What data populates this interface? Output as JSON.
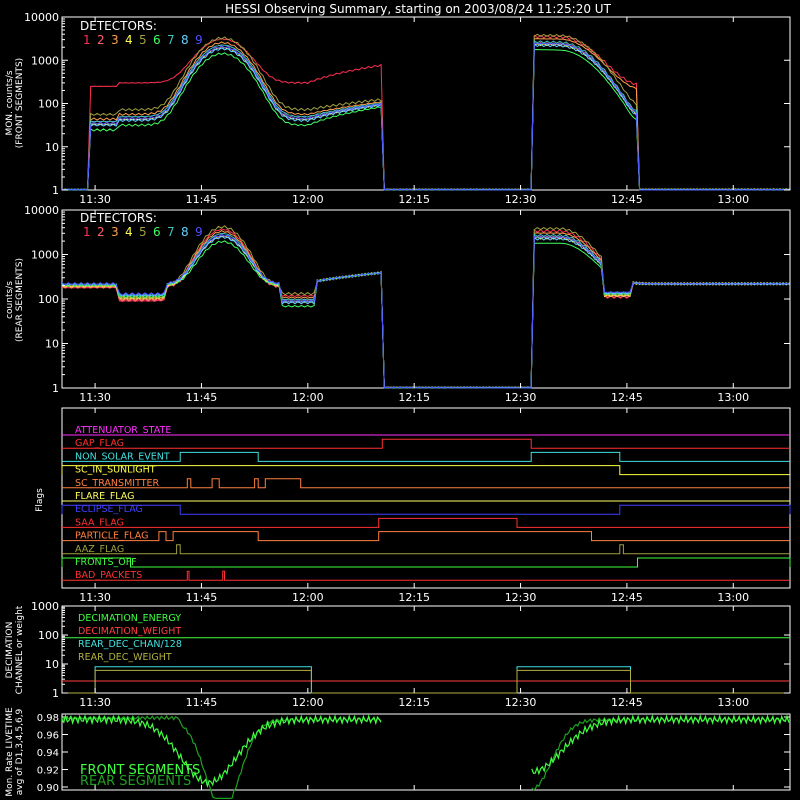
{
  "colors": {
    "background": "#000000",
    "axis": "#ffffff",
    "det": [
      "#ff3050",
      "#ff6070",
      "#ffa050",
      "#ffff50",
      "#a0a040",
      "#40ff60",
      "#40c0c0",
      "#60d0ff",
      "#5050ff"
    ]
  },
  "chart_data": [
    {
      "type": "line",
      "title": "HESSI Observing Summary, starting on 2003/08/24 11:25:20 UT",
      "ylabel": [
        "MON. counts/s",
        "(FRONT SEGMENTS)"
      ],
      "yscale": "log",
      "ylim": [
        1,
        10000
      ],
      "xlim": [
        "11:25:20",
        "13:08:00"
      ],
      "x_ticks": [
        "11:30",
        "11:45",
        "12:00",
        "12:15",
        "12:30",
        "12:45",
        "13:00"
      ],
      "y_ticks": [
        "1",
        "10",
        "100",
        "1000",
        "10000"
      ],
      "legend_title": "DETECTORS:",
      "legend_entries": [
        "1",
        "2",
        "3",
        "4",
        "5",
        "6",
        "7",
        "8",
        "9"
      ],
      "series_profile": {
        "data_gaps": [
          [
            "11:25:20",
            "11:29:00"
          ],
          [
            "12:10:30",
            "12:31:30"
          ],
          [
            "12:46:30",
            "13:08:00"
          ]
        ],
        "peak": {
          "time": "11:48",
          "value": 2000
        },
        "det1_plateau": 300
      }
    },
    {
      "type": "line",
      "ylabel": [
        "counts/s",
        "(REAR SEGMENTS)"
      ],
      "yscale": "log",
      "ylim": [
        1,
        10000
      ],
      "x_ticks": [
        "11:30",
        "11:45",
        "12:00",
        "12:15",
        "12:30",
        "12:45",
        "13:00"
      ],
      "y_ticks": [
        "1",
        "10",
        "100",
        "1000",
        "10000"
      ],
      "legend_title": "DETECTORS:",
      "legend_entries": [
        "1",
        "2",
        "3",
        "4",
        "5",
        "6",
        "7",
        "8",
        "9"
      ],
      "series_profile": {
        "data_gaps": [
          [
            "12:10:30",
            "12:31:30"
          ]
        ],
        "peak": {
          "time": "11:48",
          "value": 2500
        },
        "baseline": 200
      }
    },
    {
      "type": "line",
      "ylabel": "Flags",
      "x_ticks": [
        "11:30",
        "11:45",
        "12:00",
        "12:15",
        "12:30",
        "12:45",
        "13:00"
      ],
      "flags": [
        {
          "name": "ATTENUATOR_STATE",
          "color": "#ff30ff",
          "on": []
        },
        {
          "name": "GAP_FLAG",
          "color": "#ff3030",
          "on": [
            [
              "12:10:30",
              "12:31:30"
            ]
          ]
        },
        {
          "name": "NON_SOLAR_EVENT",
          "color": "#40e0e0",
          "on": [
            [
              "11:42:00",
              "11:53:00"
            ],
            [
              "12:31:30",
              "12:44:00"
            ]
          ]
        },
        {
          "name": "SC_IN_SUNLIGHT",
          "color": "#ffff40",
          "on": [
            [
              "11:25:20",
              "12:44:00"
            ]
          ]
        },
        {
          "name": "SC_TRANSMITTER",
          "color": "#ff8040",
          "on": [
            [
              "11:43:00",
              "11:43:30"
            ],
            [
              "11:46:30",
              "11:47:30"
            ],
            [
              "11:52:30",
              "11:53:00"
            ],
            [
              "11:54:00",
              "11:59:00"
            ]
          ]
        },
        {
          "name": "FLARE_FLAG",
          "color": "#ffff60",
          "on": []
        },
        {
          "name": "ECLIPSE_FLAG",
          "color": "#4040ff",
          "on": [
            [
              "11:25:20",
              "11:42:00"
            ],
            [
              "12:44:00",
              "13:08:00"
            ]
          ]
        },
        {
          "name": "SAA_FLAG",
          "color": "#ff3030",
          "on": [
            [
              "12:10:00",
              "12:29:30"
            ]
          ]
        },
        {
          "name": "PARTICLE_FLAG",
          "color": "#ff8040",
          "on": [
            [
              "11:39:00",
              "11:40:00"
            ],
            [
              "11:41:00",
              "11:53:00"
            ],
            [
              "12:10:00",
              "12:40:00"
            ]
          ]
        },
        {
          "name": "AAZ_FLAG",
          "color": "#a0a040",
          "on": [
            [
              "11:41:30",
              "11:42:00"
            ],
            [
              "12:44:00",
              "12:44:30"
            ]
          ]
        },
        {
          "name": "FRONTS_OFF",
          "color": "#40ff40",
          "on": [
            [
              "11:25:20",
              "11:35:00"
            ],
            [
              "12:46:30",
              "13:08:00"
            ]
          ]
        },
        {
          "name": "BAD_PACKETS",
          "color": "#ff3030",
          "on": [
            [
              "11:43:00",
              "11:43:15"
            ],
            [
              "11:48:00",
              "11:48:15"
            ]
          ]
        }
      ]
    },
    {
      "type": "line",
      "ylabel": [
        "DECIMATION",
        "CHANNEL or weight"
      ],
      "yscale": "log",
      "ylim": [
        1,
        1000
      ],
      "x_ticks": [
        "11:30",
        "11:45",
        "12:00",
        "12:15",
        "12:30",
        "12:45",
        "13:00"
      ],
      "y_ticks": [
        "1",
        "10",
        "100",
        "1000"
      ],
      "legend_entries": [
        {
          "name": "DECIMATION_ENERGY",
          "color": "#40ff40"
        },
        {
          "name": "DECIMATION_WEIGHT",
          "color": "#ff4040"
        },
        {
          "name": "REAR_DEC_CHAN/128",
          "color": "#40e0e0"
        },
        {
          "name": "REAR_DEC_WEIGHT",
          "color": "#b0b040"
        }
      ],
      "series": [
        {
          "name": "DECIMATION_ENERGY",
          "value": 80
        },
        {
          "name": "DECIMATION_WEIGHT",
          "value": 2.6
        },
        {
          "name": "REAR_DEC_CHAN/128",
          "segments": [
            [
              "11:30:00",
              "12:00:30",
              8
            ],
            [
              "12:29:30",
              "12:45:30",
              8
            ]
          ],
          "base": 1
        },
        {
          "name": "REAR_DEC_WEIGHT",
          "segments": [
            [
              "11:30:00",
              "12:00:30",
              6
            ],
            [
              "12:29:30",
              "12:45:30",
              6
            ]
          ],
          "base": 1
        }
      ]
    },
    {
      "type": "line",
      "ylabel": [
        "Mon. Rate LIVETIME",
        "avg of D1,3,4,5,6,9"
      ],
      "ylim": [
        0.9,
        0.98
      ],
      "x_ticks": [
        "11:30",
        "11:45",
        "12:00",
        "12:15",
        "12:30",
        "12:45",
        "13:00"
      ],
      "y_ticks": [
        "0.90",
        "0.92",
        "0.94",
        "0.96",
        "0.98"
      ],
      "legend_entries": [
        {
          "name": "FRONT SEGMENTS",
          "color": "#40ff40"
        },
        {
          "name": "REAR SEGMENTS",
          "color": "#20a020"
        }
      ],
      "series_profile": {
        "baseline": 0.977,
        "dip_front": {
          "time": "11:46",
          "value": 0.905
        },
        "dip_rear": {
          "time": "11:48",
          "value": 0.88
        }
      }
    }
  ]
}
